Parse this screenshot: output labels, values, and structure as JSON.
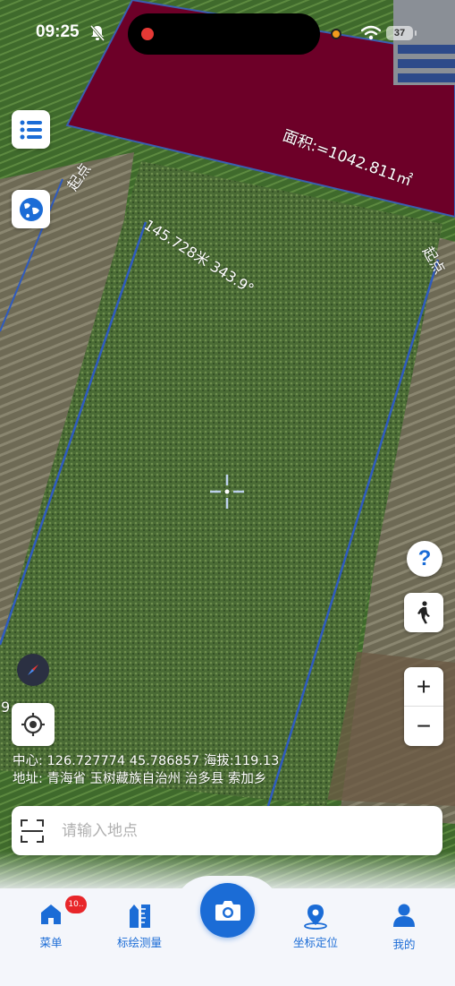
{
  "status_bar": {
    "time": "09:25",
    "battery": "37"
  },
  "map": {
    "area_label": "面积:=1042.811㎡",
    "start_label_left": "起点",
    "start_label_right": "起点",
    "edge_measure_label": "145.728米 343.9°",
    "edge_fragment_left": "9",
    "colors": {
      "plot_fill": "#6d0028",
      "plot_border": "#3a5fb0",
      "boundary_line": "#2f5bbf"
    }
  },
  "info": {
    "center": "中心:  126.727774 45.786857 海拔:119.13",
    "address": "地址:  青海省 玉树藏族自治州 治多县 索加乡"
  },
  "search": {
    "placeholder": "请输入地点"
  },
  "tabbar": {
    "items": [
      {
        "label": "菜单",
        "icon": "home-icon"
      },
      {
        "label": "标绘测量",
        "icon": "ruler-icon"
      },
      {
        "label": "坐标定位",
        "icon": "location-pin-icon"
      },
      {
        "label": "我的",
        "icon": "user-icon"
      }
    ],
    "badge": "10..",
    "accent": "#1b6cd6"
  },
  "controls": {
    "help": "?",
    "zoom_in": "+",
    "zoom_out": "−"
  }
}
